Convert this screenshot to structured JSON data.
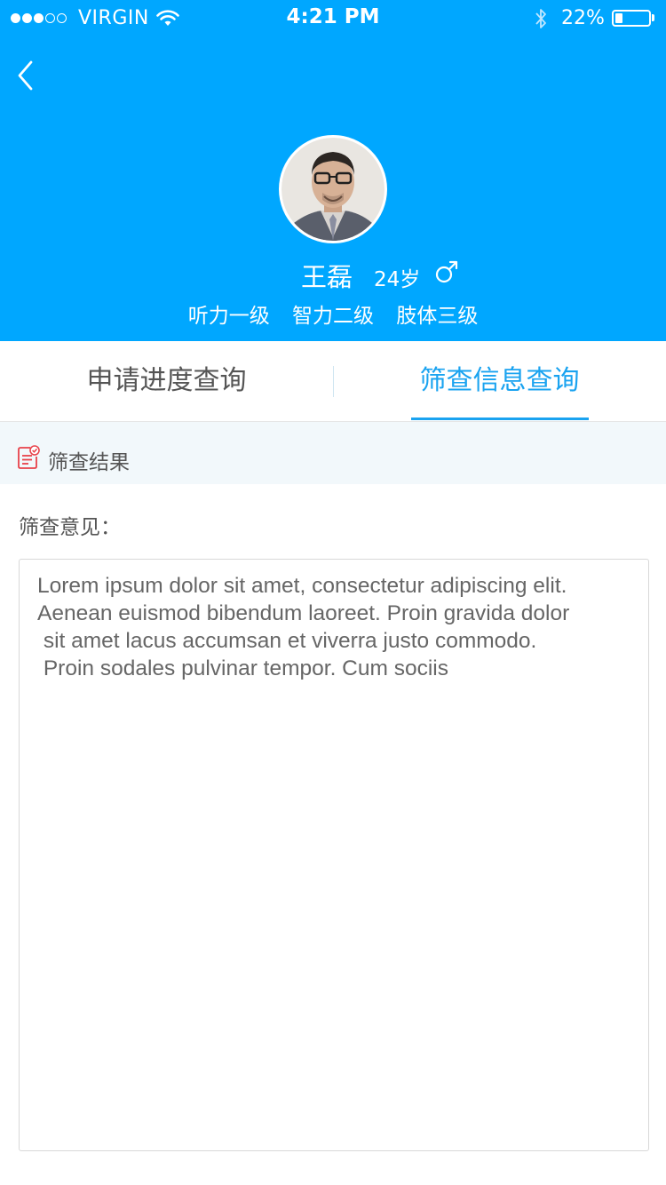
{
  "status_bar": {
    "signal_dots": [
      "full",
      "full",
      "full",
      "empty",
      "empty"
    ],
    "carrier": "VIRGIN",
    "time": "4:21 PM",
    "battery_percent": "22%",
    "battery_level": 0.22
  },
  "nav": {
    "back_icon": "chevron-left-icon"
  },
  "profile": {
    "name": "王磊",
    "age": "24岁",
    "gender_icon": "male-icon",
    "levels": [
      "听力一级",
      "智力二级",
      "肢体三级"
    ]
  },
  "tabs": [
    {
      "label": "申请进度查询",
      "active": false
    },
    {
      "label": "筛查信息查询",
      "active": true
    }
  ],
  "section": {
    "icon": "document-check-icon",
    "title": "筛查结果"
  },
  "opinion": {
    "label": "筛查意见：",
    "text": "Lorem ipsum dolor sit amet, consectetur adipiscing elit.\nAenean euismod bibendum laoreet. Proin gravida dolor\n sit amet lacus accumsan et viverra justo commodo.\n Proin sodales pulvinar tempor. Cum sociis"
  },
  "colors": {
    "header_bg": "#00a7ff",
    "accent": "#1aa3f0",
    "section_bg": "#f2f8fb",
    "icon_red": "#e8424a"
  }
}
